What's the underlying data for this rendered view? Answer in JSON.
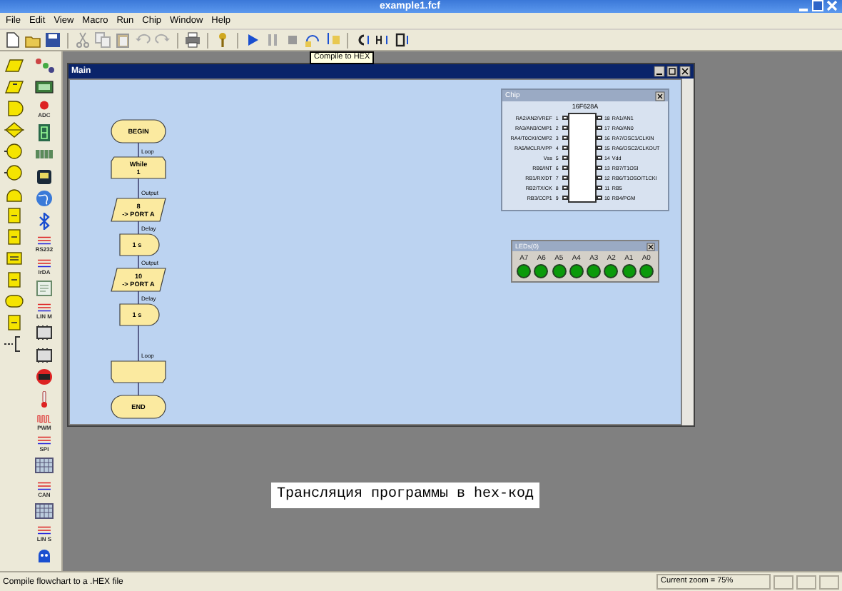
{
  "window": {
    "title": "example1.fcf"
  },
  "menu": [
    "File",
    "Edit",
    "View",
    "Macro",
    "Run",
    "Chip",
    "Window",
    "Help"
  ],
  "toolbar": [
    {
      "kind": "new"
    },
    {
      "kind": "open"
    },
    {
      "kind": "save"
    },
    {
      "kind": "sep"
    },
    {
      "kind": "cut"
    },
    {
      "kind": "copy"
    },
    {
      "kind": "paste"
    },
    {
      "kind": "undo"
    },
    {
      "kind": "redo"
    },
    {
      "kind": "sep"
    },
    {
      "kind": "print"
    },
    {
      "kind": "sep"
    },
    {
      "kind": "key"
    },
    {
      "kind": "sep"
    },
    {
      "kind": "play"
    },
    {
      "kind": "pause"
    },
    {
      "kind": "stop"
    },
    {
      "kind": "step-over"
    },
    {
      "kind": "step-into"
    },
    {
      "kind": "sep"
    },
    {
      "kind": "compile-c"
    },
    {
      "kind": "compile-hex"
    },
    {
      "kind": "compile-chip"
    }
  ],
  "tooltip": "Compile to HEX",
  "palette": {
    "flowchart_icons": [
      {
        "kind": "input"
      },
      {
        "kind": "output"
      },
      {
        "kind": "delay"
      },
      {
        "kind": "decision"
      },
      {
        "kind": "call"
      },
      {
        "kind": "call"
      },
      {
        "kind": "loop"
      },
      {
        "kind": "block"
      },
      {
        "kind": "block"
      },
      {
        "kind": "calc"
      },
      {
        "kind": "block"
      },
      {
        "kind": "oval"
      },
      {
        "kind": "block"
      },
      {
        "kind": "comment"
      }
    ],
    "component_icons": [
      {
        "kind": "network"
      },
      {
        "kind": "board"
      },
      {
        "kind": "sensor",
        "label": "ADC"
      },
      {
        "kind": "segment"
      },
      {
        "kind": "keys"
      },
      {
        "kind": "lcd"
      },
      {
        "kind": "globe"
      },
      {
        "kind": "bluetooth"
      },
      {
        "kind": "bus",
        "label": "RS232"
      },
      {
        "kind": "bus",
        "label": "IrDA"
      },
      {
        "kind": "document"
      },
      {
        "kind": "bus",
        "label": "LIN M"
      },
      {
        "kind": "chip"
      },
      {
        "kind": "chip"
      },
      {
        "kind": "motor"
      },
      {
        "kind": "thermometer"
      },
      {
        "kind": "wave",
        "label": "PWM"
      },
      {
        "kind": "bus",
        "label": "SPI"
      },
      {
        "kind": "grid"
      },
      {
        "kind": "bus",
        "label": "CAN"
      },
      {
        "kind": "grid"
      },
      {
        "kind": "bus",
        "label": "LIN S"
      },
      {
        "kind": "robot"
      }
    ]
  },
  "main_window": {
    "title": "Main",
    "flowchart": [
      {
        "kind": "terminal",
        "lines": [
          "BEGIN"
        ]
      },
      {
        "kind": "loop-start",
        "label": "Loop",
        "lines": [
          "While",
          "1"
        ]
      },
      {
        "kind": "output",
        "label": "Output",
        "lines": [
          "8",
          "-> PORT A"
        ]
      },
      {
        "kind": "delay",
        "label": "Delay",
        "lines": [
          "1 s"
        ]
      },
      {
        "kind": "output",
        "label": "Output",
        "lines": [
          "10",
          "-> PORT A"
        ]
      },
      {
        "kind": "delay",
        "label": "Delay",
        "lines": [
          "1 s"
        ]
      },
      {
        "kind": "loop-end",
        "label": "Loop"
      },
      {
        "kind": "terminal",
        "lines": [
          "END"
        ]
      }
    ]
  },
  "chip_panel": {
    "title": "Chip",
    "chip_name": "16F628A",
    "left_pins": [
      {
        "number": "1",
        "name": "RA2/AN2/VREF"
      },
      {
        "number": "2",
        "name": "RA3/AN3/CMP1"
      },
      {
        "number": "3",
        "name": "RA4/T0CKI/CMP2"
      },
      {
        "number": "4",
        "name": "RA5/MCLR/VPP"
      },
      {
        "number": "5",
        "name": "Vss"
      },
      {
        "number": "6",
        "name": "RB0/INT"
      },
      {
        "number": "7",
        "name": "RB1/RX/DT"
      },
      {
        "number": "8",
        "name": "RB2/TX/CK"
      },
      {
        "number": "9",
        "name": "RB3/CCP1"
      }
    ],
    "right_pins": [
      {
        "number": "18",
        "name": "RA1/AN1"
      },
      {
        "number": "17",
        "name": "RA0/AN0"
      },
      {
        "number": "16",
        "name": "RA7/OSC1/CLKIN"
      },
      {
        "number": "15",
        "name": "RA6/OSC2/CLKOUT"
      },
      {
        "number": "14",
        "name": "Vdd"
      },
      {
        "number": "13",
        "name": "RB7/T1OSI"
      },
      {
        "number": "12",
        "name": "RB6/T1OSO/T1CKI"
      },
      {
        "number": "11",
        "name": "RB5"
      },
      {
        "number": "10",
        "name": "RB4/PGM"
      }
    ]
  },
  "led_panel": {
    "title": "LEDs(0)",
    "leds": [
      {
        "label": "A7",
        "on": true
      },
      {
        "label": "A6",
        "on": true
      },
      {
        "label": "A5",
        "on": true
      },
      {
        "label": "A4",
        "on": true
      },
      {
        "label": "A3",
        "on": true
      },
      {
        "label": "A2",
        "on": true
      },
      {
        "label": "A1",
        "on": true
      },
      {
        "label": "A0",
        "on": true
      }
    ]
  },
  "caption": "Трансляция программы в hex-код",
  "status_bar": {
    "message": "Compile flowchart to a .HEX file",
    "zoom": "Current zoom = 75%"
  }
}
